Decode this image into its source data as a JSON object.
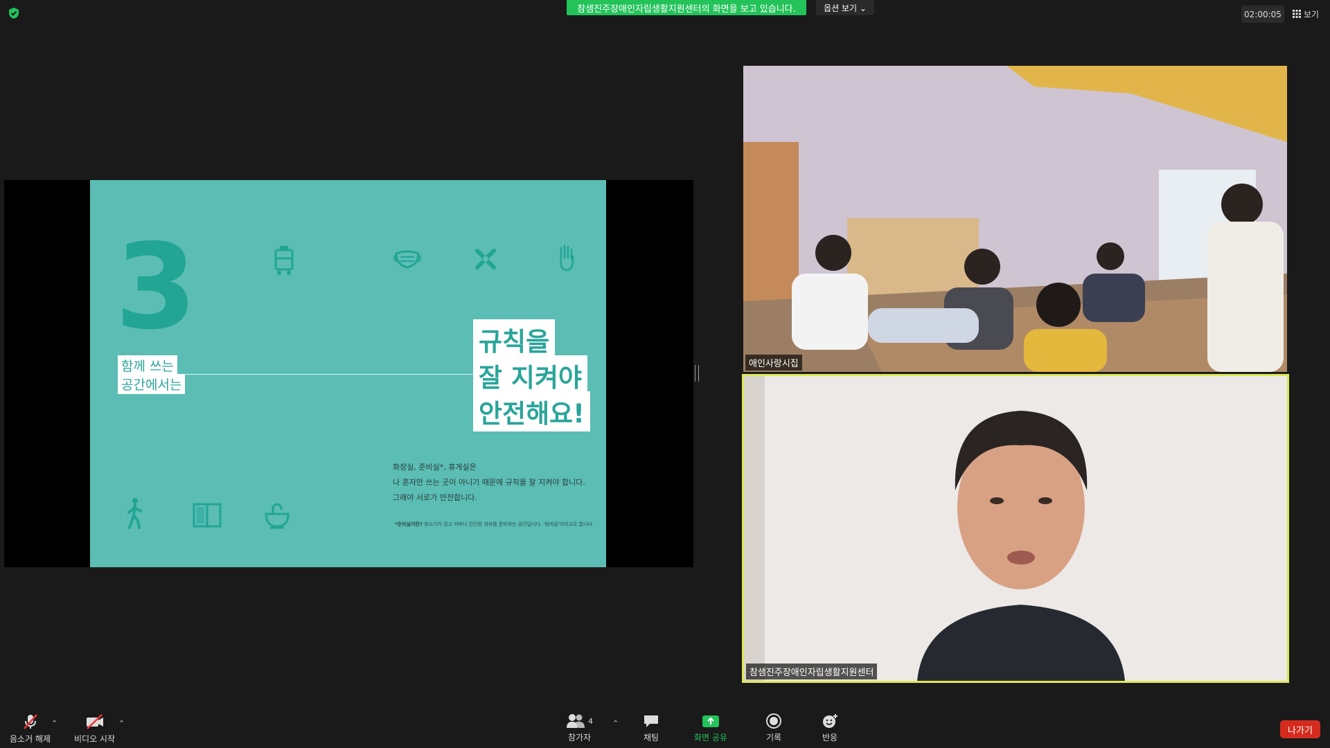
{
  "top_bar": {
    "banner": "참샘진주장애인자립생활지원센터의 화면을 보고 있습니다.",
    "view_options": "옵션 보기 ⌄",
    "timer": "02:00:05",
    "view_label": "보기"
  },
  "slide": {
    "number": "3",
    "subtitle_line1": "함께 쓰는",
    "subtitle_line2": "공간에서는",
    "headline_line1": "규칙을",
    "headline_line2": "잘 지켜야",
    "headline_line3": "안전해요!",
    "body_line1": "화장실, 준비실*, 휴게실은",
    "body_line2": "나 혼자만 쓰는 곳이 아니기 때문에 규칙을 잘 지켜야 합니다.",
    "body_line3": "그래야 서로가 안전합니다.",
    "footnote_bold": "*준비실이란?",
    "footnote_text": " 청소기가 있고 커피나 간단한 과자를 준비하는 공간입니다. '탕비실'이라고도 합니다."
  },
  "participants": [
    {
      "name": "애인사랑시집"
    },
    {
      "name": "참샘진주장애인자립생활지원센터"
    }
  ],
  "toolbar": {
    "mute": "음소거 해제",
    "video": "비디오 시작",
    "participants": "참가자",
    "participant_count": "4",
    "chat": "채팅",
    "share": "화면 공유",
    "record": "기록",
    "reactions": "반응",
    "leave": "나가기"
  },
  "colors": {
    "accent_green": "#23c35a",
    "slide_teal": "#5bbdb4",
    "active_speaker": "#dde85a",
    "leave_red": "#d52b1e"
  }
}
